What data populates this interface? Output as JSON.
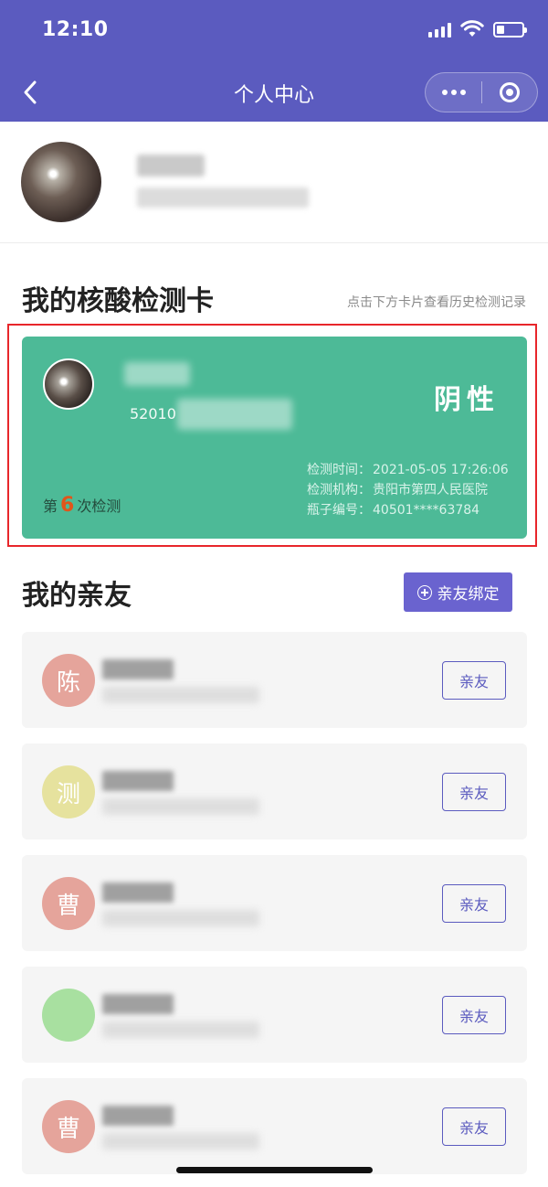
{
  "status_bar": {
    "time": "12:10"
  },
  "nav": {
    "title": "个人中心"
  },
  "section_card": {
    "title": "我的核酸检测卡",
    "hint": "点击下方卡片查看历史检测记录"
  },
  "card": {
    "id_prefix": "52010",
    "result": "阴性",
    "count_prefix": "第",
    "count": "6",
    "count_suffix": "次检测",
    "info": [
      {
        "label": "检测时间：",
        "value": "2021-05-05 17:26:06"
      },
      {
        "label": "检测机构：",
        "value": "贵阳市第四人民医院"
      },
      {
        "label": "瓶子编号：",
        "value": "40501****63784"
      }
    ]
  },
  "section_friends": {
    "title": "我的亲友",
    "bind_label": "亲友绑定"
  },
  "friends": [
    {
      "initial": "陈",
      "color": "#e5a49b",
      "tag": "亲友"
    },
    {
      "initial": "测",
      "color": "#e6e29e",
      "tag": "亲友"
    },
    {
      "initial": "曹",
      "color": "#e5a49b",
      "tag": "亲友"
    },
    {
      "initial": "",
      "color": "#a8e0a0",
      "tag": "亲友"
    },
    {
      "initial": "曹",
      "color": "#e5a49b",
      "tag": "亲友"
    }
  ],
  "colors": {
    "header": "#5b5bbf",
    "card": "#4dba97",
    "accent": "#6a63cf",
    "highlight": "#e8262b"
  },
  "icons": [
    "back-icon",
    "more-icon",
    "close-capsule-icon",
    "plus-circle-icon",
    "signal-icon",
    "wifi-icon",
    "battery-icon"
  ]
}
